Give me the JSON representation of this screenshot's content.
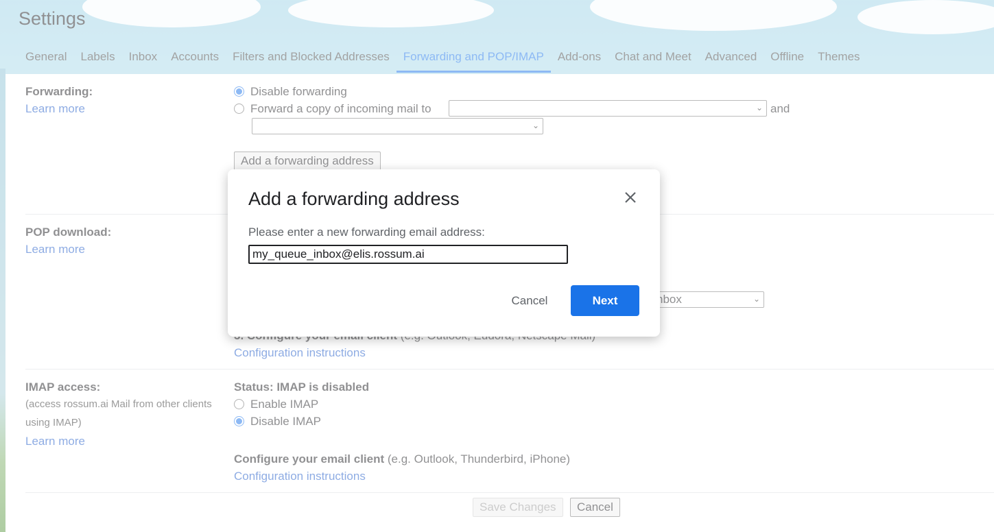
{
  "page": {
    "title": "Settings"
  },
  "tabs": [
    {
      "label": "General"
    },
    {
      "label": "Labels"
    },
    {
      "label": "Inbox"
    },
    {
      "label": "Accounts"
    },
    {
      "label": "Filters and Blocked Addresses"
    },
    {
      "label": "Forwarding and POP/IMAP",
      "active": true
    },
    {
      "label": "Add-ons"
    },
    {
      "label": "Chat and Meet"
    },
    {
      "label": "Advanced"
    },
    {
      "label": "Offline"
    },
    {
      "label": "Themes"
    }
  ],
  "forwarding": {
    "label": "Forwarding:",
    "learn_more": "Learn more",
    "option_disable": "Disable forwarding",
    "option_forward": "Forward a copy of incoming mail to",
    "and": "and",
    "add_button": "Add a forwarding address"
  },
  "pop": {
    "label": "POP download:",
    "learn_more": "Learn more",
    "select_partial": "nbox",
    "step3_bold": "3. Configure your email client",
    "step3_rest": " (e.g. Outlook, Eudora, Netscape Mail)",
    "config_link": "Configuration instructions"
  },
  "imap": {
    "label": "IMAP access:",
    "sub1": "(access rossum.ai Mail from other clients",
    "sub2": "using IMAP)",
    "learn_more": "Learn more",
    "status": "Status: IMAP is disabled",
    "enable": "Enable IMAP",
    "disable": "Disable IMAP",
    "configure_bold": "Configure your email client",
    "configure_rest": " (e.g. Outlook, Thunderbird, iPhone)",
    "config_link": "Configuration instructions"
  },
  "footer": {
    "save": "Save Changes",
    "cancel": "Cancel"
  },
  "dialog": {
    "title": "Add a forwarding address",
    "prompt": "Please enter a new forwarding email address:",
    "input_value": "my_queue_inbox@elis.rossum.ai",
    "cancel": "Cancel",
    "next": "Next"
  },
  "colors": {
    "accent": "#1a73e8",
    "link": "#1a57c6"
  }
}
